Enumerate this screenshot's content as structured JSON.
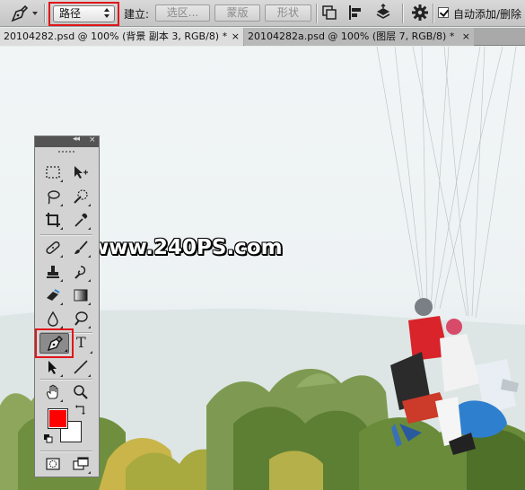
{
  "options_bar": {
    "tool_icon": "pen-icon",
    "mode_value": "路径",
    "make_label": "建立:",
    "selection_button": "选区...",
    "mask_button": "蒙版",
    "shape_button": "形状",
    "path_ops_icon": "path-operations-icon",
    "path_align_icon": "path-alignment-icon",
    "path_arrange_icon": "path-arrangement-icon",
    "settings_icon": "gear-icon",
    "auto_add_delete_label": "自动添加/删除",
    "auto_add_delete_checked": true
  },
  "tabs": [
    {
      "label": "20104282.psd @ 100% (背景 副本 3, RGB/8) *",
      "close": "×",
      "active": true
    },
    {
      "label": "20104282a.psd @ 100% (图层 7, RGB/8) *",
      "close": "×",
      "active": false
    }
  ],
  "canvas": {
    "watermark": "www.240PS.com"
  },
  "toolbox": {
    "collapse_glyph": "◂◂",
    "close_glyph": "×",
    "type_tool_glyph": "T",
    "active_tool": "pen-icon",
    "foreground_color": "#ff0000",
    "background_color": "#ffffff"
  },
  "colors": {
    "highlight_red": "#e0161b"
  }
}
